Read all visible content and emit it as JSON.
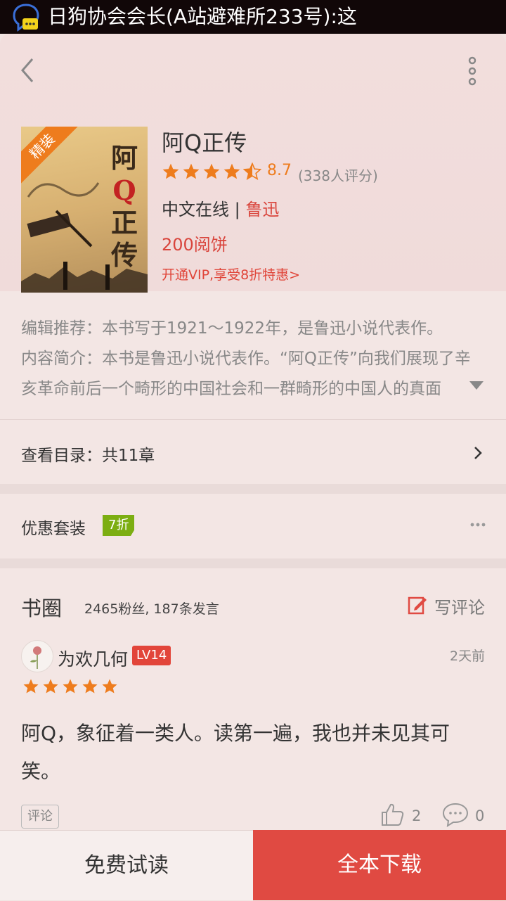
{
  "status_bar": {
    "notification_text": "日狗协会会长(A站避难所233号):这",
    "notification_icon": "chat-bubble-icon"
  },
  "header": {
    "back_icon": "chevron-left-icon",
    "more_icon": "vertical-dots-icon"
  },
  "book": {
    "cover_badge": "精装",
    "cover_title_chars": [
      "阿",
      "Q",
      "正",
      "传"
    ],
    "title": "阿Q正传",
    "rating_stars": 4.5,
    "rating_value": "8.7",
    "rating_count": "(338人评分)",
    "publisher": "中文在线",
    "separator": " | ",
    "author": "鲁迅",
    "price": "200阅饼",
    "vip_offer": "开通VIP,享受8折特惠>"
  },
  "description": {
    "editor_pick": "编辑推荐：本书写于1921～1922年，是鲁迅小说代表作。",
    "summary_line1": "内容简介：本书是鲁迅小说代表作。“阿Q正传”向我们展现了辛",
    "summary_line2": "亥革命前后一个畸形的中国社会和一群畸形的中国人的真面"
  },
  "toc": {
    "label": "查看目录：共11章"
  },
  "bundle": {
    "label": "优惠套装",
    "badge": "7折"
  },
  "book_circle": {
    "title": "书圈",
    "stats": "2465粉丝, 187条发言",
    "write_label": "写评论"
  },
  "review": {
    "username": "为欢几何",
    "level": "LV14",
    "time": "2天前",
    "stars": 5,
    "text": "阿Q，象征着一类人。读第一遍，我也并未见其可笑。",
    "tag": "评论",
    "likes": "2",
    "comments": "0"
  },
  "bottom_bar": {
    "trial_label": "免费试读",
    "buy_label": "全本下载"
  },
  "colors": {
    "accent_red": "#e04a42",
    "rating_orange": "#ee7c1d",
    "badge_green": "#7cae12"
  }
}
